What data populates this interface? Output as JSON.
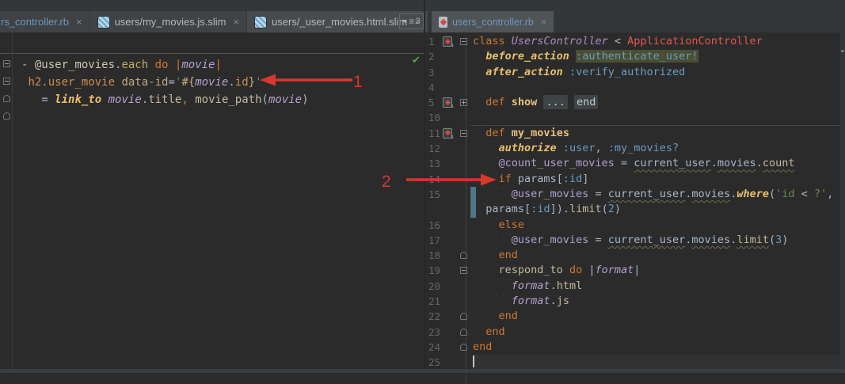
{
  "tabs": {
    "left_group": [
      {
        "label": "rs_controller.rb",
        "icon": "none",
        "modified": true,
        "state": "normal"
      },
      {
        "label": "users/my_movies.js.slim",
        "icon": "slim",
        "modified": false,
        "state": "normal"
      },
      {
        "label": "users/_user_movies.html.slim",
        "icon": "slim",
        "modified": false,
        "state": "sel"
      }
    ],
    "hidden_tabs_count": "3",
    "right_group": [
      {
        "label": "users_controller.rb",
        "icon": "ruby",
        "modified": true,
        "state": "active"
      }
    ]
  },
  "left_editor": {
    "status": "inspections-ok",
    "fold_markers": [
      "f-minus",
      "f-minus",
      "f-end",
      "f-end"
    ],
    "rows": [
      {
        "s": [
          {
            "t": "- ",
            "c": "plain"
          },
          {
            "t": "@user_movies",
            "c": "lvar"
          },
          {
            "t": ".",
            "c": "plain"
          },
          {
            "t": "each",
            "c": "lmeth"
          },
          {
            "t": " ",
            "c": "plain"
          },
          {
            "t": "do",
            "c": "kw"
          },
          {
            "t": " ",
            "c": "plain"
          },
          {
            "t": "|",
            "c": "kw"
          },
          {
            "t": "movie",
            "c": "param"
          },
          {
            "t": "|",
            "c": "kw"
          }
        ]
      },
      {
        "s": [
          {
            "t": " ",
            "c": "ind"
          },
          {
            "t": "h2.user_movie",
            "c": "ltag"
          },
          {
            "t": " ",
            "c": "plain"
          },
          {
            "t": "data-id",
            "c": "lattr"
          },
          {
            "t": "=",
            "c": "plain"
          },
          {
            "t": "'",
            "c": "str"
          },
          {
            "t": "#{",
            "c": "interp"
          },
          {
            "t": "movie",
            "c": "param"
          },
          {
            "t": ".",
            "c": "plain"
          },
          {
            "t": "id",
            "c": "ltag"
          },
          {
            "t": "}",
            "c": "interp"
          },
          {
            "t": "'",
            "c": "str"
          }
        ]
      },
      {
        "s": [
          {
            "t": "   ",
            "c": "ind"
          },
          {
            "t": "= ",
            "c": "plain"
          },
          {
            "t": "link_to",
            "c": "mcall"
          },
          {
            "t": " ",
            "c": "plain"
          },
          {
            "t": "movie",
            "c": "param"
          },
          {
            "t": ".",
            "c": "plain"
          },
          {
            "t": "title",
            "c": "cream"
          },
          {
            "t": ",",
            "c": "lcomma"
          },
          {
            "t": " ",
            "c": "plain"
          },
          {
            "t": "movie_path",
            "c": "cream"
          },
          {
            "t": "(",
            "c": "plain"
          },
          {
            "t": "movie",
            "c": "param"
          },
          {
            "t": ")",
            "c": "plain"
          }
        ]
      }
    ]
  },
  "right_editor": {
    "rows": [
      {
        "n": "1",
        "b": 1,
        "f": "f-minus",
        "s": [
          {
            "t": "class",
            "c": "kw"
          },
          {
            "t": " ",
            "c": "plain"
          },
          {
            "t": "UsersController",
            "c": "const"
          },
          {
            "t": " < ",
            "c": "plain"
          },
          {
            "t": "ApplicationController",
            "c": "superc"
          }
        ]
      },
      {
        "n": "2",
        "s": [
          {
            "t": "  ",
            "c": "ind"
          },
          {
            "t": "before_action",
            "c": "mcall"
          },
          {
            "t": " ",
            "c": "plain"
          },
          {
            "t": ":authenticate_user!",
            "c": "sym hl"
          }
        ]
      },
      {
        "n": "3",
        "s": [
          {
            "t": "  ",
            "c": "ind"
          },
          {
            "t": "after_action",
            "c": "mcall"
          },
          {
            "t": " ",
            "c": "plain"
          },
          {
            "t": ":verify_authorized",
            "c": "sym"
          }
        ]
      },
      {
        "n": "4",
        "s": []
      },
      {
        "n": "5",
        "b": 1,
        "f": "f-plus",
        "s": [
          {
            "t": "  ",
            "c": "ind"
          },
          {
            "t": "def",
            "c": "kw"
          },
          {
            "t": " ",
            "c": "plain"
          },
          {
            "t": "show",
            "c": "mdef"
          },
          {
            "t": " ",
            "c": "plain"
          },
          {
            "t": "...",
            "c": "fold-chip"
          },
          {
            "t": " ",
            "c": "plain"
          },
          {
            "t": "end",
            "c": "fold-chip"
          }
        ]
      },
      {
        "n": "10",
        "s": []
      },
      {
        "n": "11",
        "b": 1,
        "f": "f-minus",
        "p": 1,
        "s": [
          {
            "t": "  ",
            "c": "ind"
          },
          {
            "t": "def",
            "c": "kw"
          },
          {
            "t": " ",
            "c": "plain"
          },
          {
            "t": "my_movies",
            "c": "mdef"
          }
        ]
      },
      {
        "n": "12",
        "s": [
          {
            "t": "    ",
            "c": "ind"
          },
          {
            "t": "authorize",
            "c": "mcall"
          },
          {
            "t": " ",
            "c": "plain"
          },
          {
            "t": ":user",
            "c": "sym"
          },
          {
            "t": ", ",
            "c": "plain"
          },
          {
            "t": ":my_movies?",
            "c": "sym"
          }
        ]
      },
      {
        "n": "13",
        "s": [
          {
            "t": "    ",
            "c": "ind"
          },
          {
            "t": "@count_user_movies",
            "c": "ivar"
          },
          {
            "t": " = ",
            "c": "plain"
          },
          {
            "t": "current_user",
            "c": "plain wavy"
          },
          {
            "t": ".",
            "c": "plain"
          },
          {
            "t": "movies",
            "c": "plain wavy"
          },
          {
            "t": ".",
            "c": "plain"
          },
          {
            "t": "count",
            "c": "cream wavy"
          }
        ]
      },
      {
        "n": "14",
        "s": [
          {
            "t": "    ",
            "c": "ind"
          },
          {
            "t": "if",
            "c": "kw"
          },
          {
            "t": " ",
            "c": "plain"
          },
          {
            "t": "params",
            "c": "plain"
          },
          {
            "t": "[",
            "c": "plain"
          },
          {
            "t": ":id",
            "c": "sym"
          },
          {
            "t": "]",
            "c": "plain"
          }
        ]
      },
      {
        "n": "15",
        "s": [
          {
            "t": "      ",
            "c": "ind"
          },
          {
            "t": "@user_movies",
            "c": "ivar"
          },
          {
            "t": " = ",
            "c": "plain"
          },
          {
            "t": "current_user",
            "c": "plain wavy"
          },
          {
            "t": ".",
            "c": "plain"
          },
          {
            "t": "movies",
            "c": "plain wavy"
          },
          {
            "t": ".",
            "c": "plain"
          },
          {
            "t": "where",
            "c": "mcall"
          },
          {
            "t": "(",
            "c": "plain"
          },
          {
            "t": "'id ",
            "c": "str"
          },
          {
            "t": "< ",
            "c": "plain"
          },
          {
            "t": "?'",
            "c": "str"
          },
          {
            "t": ",",
            "c": "plain"
          }
        ]
      },
      {
        "n": "",
        "s": [
          {
            "t": "  ",
            "c": "ind"
          },
          {
            "t": "params",
            "c": "plain"
          },
          {
            "t": "[",
            "c": "plain"
          },
          {
            "t": ":id",
            "c": "sym"
          },
          {
            "t": "]",
            "c": "plain"
          },
          {
            "t": ")",
            "c": "plain"
          },
          {
            "t": ".",
            "c": "plain"
          },
          {
            "t": "limit",
            "c": "cream"
          },
          {
            "t": "(",
            "c": "plain"
          },
          {
            "t": "2",
            "c": "num"
          },
          {
            "t": ")",
            "c": "plain"
          }
        ]
      },
      {
        "n": "16",
        "s": [
          {
            "t": "    ",
            "c": "ind"
          },
          {
            "t": "else",
            "c": "kw"
          }
        ]
      },
      {
        "n": "17",
        "s": [
          {
            "t": "      ",
            "c": "ind"
          },
          {
            "t": "@user_movies",
            "c": "ivar"
          },
          {
            "t": " = ",
            "c": "plain"
          },
          {
            "t": "current_user",
            "c": "plain wavy"
          },
          {
            "t": ".",
            "c": "plain"
          },
          {
            "t": "movies",
            "c": "plain wavy"
          },
          {
            "t": ".",
            "c": "plain"
          },
          {
            "t": "limit",
            "c": "cream wavy"
          },
          {
            "t": "(",
            "c": "plain"
          },
          {
            "t": "3",
            "c": "num"
          },
          {
            "t": ")",
            "c": "plain"
          }
        ]
      },
      {
        "n": "18",
        "f": "f-end",
        "s": [
          {
            "t": "    ",
            "c": "ind"
          },
          {
            "t": "end",
            "c": "kw"
          }
        ]
      },
      {
        "n": "19",
        "f": "f-minus",
        "s": [
          {
            "t": "    ",
            "c": "ind"
          },
          {
            "t": "respond_to",
            "c": "cream"
          },
          {
            "t": " ",
            "c": "plain"
          },
          {
            "t": "do",
            "c": "kw"
          },
          {
            "t": " ",
            "c": "plain"
          },
          {
            "t": "|",
            "c": "plain"
          },
          {
            "t": "format",
            "c": "param"
          },
          {
            "t": "|",
            "c": "plain"
          }
        ]
      },
      {
        "n": "20",
        "s": [
          {
            "t": "      ",
            "c": "ind"
          },
          {
            "t": "format",
            "c": "param"
          },
          {
            "t": ".",
            "c": "plain"
          },
          {
            "t": "html",
            "c": "cream"
          }
        ]
      },
      {
        "n": "21",
        "s": [
          {
            "t": "      ",
            "c": "ind"
          },
          {
            "t": "format",
            "c": "param"
          },
          {
            "t": ".",
            "c": "plain"
          },
          {
            "t": "js",
            "c": "cream"
          }
        ]
      },
      {
        "n": "22",
        "f": "f-end",
        "s": [
          {
            "t": "    ",
            "c": "ind"
          },
          {
            "t": "end",
            "c": "kw"
          }
        ]
      },
      {
        "n": "23",
        "f": "f-end",
        "s": [
          {
            "t": "  ",
            "c": "ind"
          },
          {
            "t": "end",
            "c": "kw"
          }
        ]
      },
      {
        "n": "24",
        "f": "f-end",
        "s": [
          {
            "t": "end",
            "c": "kw"
          }
        ]
      },
      {
        "n": "25",
        "c": 1,
        "s": []
      }
    ]
  },
  "annotations": {
    "arrow1_label": "1",
    "arrow2_label": "2",
    "color": "#d6392c"
  },
  "colors": {
    "editor_bg": "#2b2b2b",
    "tabbar_bg": "#34373a",
    "active_tab_bg": "#4f5456",
    "modified_tab_text": "#6d96bd",
    "keyword": "#cc7832",
    "symbol": "#6a9bc5",
    "string": "#6a8759",
    "instance_var": "#b0a0ce",
    "vcs_changed_strip": "#50748a",
    "annotation_red": "#d6392c",
    "inspection_ok_green": "#55a747"
  }
}
